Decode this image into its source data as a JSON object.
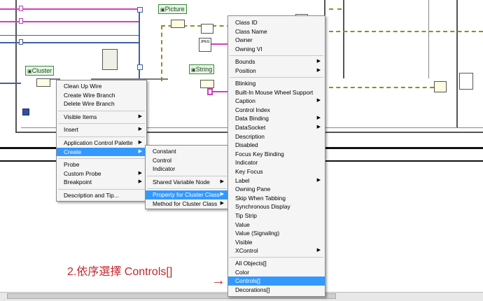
{
  "diagram": {
    "labels": {
      "cluster": "Cluster",
      "picture": "Picture",
      "string": "String",
      "jpeg": "JPEG"
    }
  },
  "context_menu": {
    "items": [
      {
        "label": "Clean Up Wire",
        "submenu": false
      },
      {
        "label": "Create Wire Branch",
        "submenu": false
      },
      {
        "label": "Delete Wire Branch",
        "submenu": false
      },
      {
        "label": "Visible Items",
        "submenu": true
      },
      {
        "label": "Insert",
        "submenu": true
      },
      {
        "label": "Application Control Palette",
        "submenu": true
      },
      {
        "label": "Create",
        "submenu": true,
        "selected": true
      },
      {
        "label": "Probe",
        "submenu": false
      },
      {
        "label": "Custom Probe",
        "submenu": true
      },
      {
        "label": "Breakpoint",
        "submenu": true
      },
      {
        "label": "Description and Tip...",
        "submenu": false
      }
    ]
  },
  "create_menu": {
    "items": [
      {
        "label": "Constant",
        "submenu": false
      },
      {
        "label": "Control",
        "submenu": false
      },
      {
        "label": "Indicator",
        "submenu": false
      },
      {
        "label": "Shared Variable Node",
        "submenu": true
      },
      {
        "label": "Property for Cluster Class",
        "submenu": true,
        "selected": true
      },
      {
        "label": "Method for Cluster Class",
        "submenu": true
      }
    ]
  },
  "property_menu": {
    "items": [
      {
        "label": "Class ID",
        "submenu": false
      },
      {
        "label": "Class Name",
        "submenu": false
      },
      {
        "label": "Owner",
        "submenu": false
      },
      {
        "label": "Owning VI",
        "submenu": false
      },
      {
        "label": "Bounds",
        "submenu": true
      },
      {
        "label": "Position",
        "submenu": true
      },
      {
        "label": "Blinking",
        "submenu": false
      },
      {
        "label": "Built-In Mouse Wheel Support",
        "submenu": false
      },
      {
        "label": "Caption",
        "submenu": true
      },
      {
        "label": "Control Index",
        "submenu": false
      },
      {
        "label": "Data Binding",
        "submenu": true
      },
      {
        "label": "DataSocket",
        "submenu": true
      },
      {
        "label": "Description",
        "submenu": false
      },
      {
        "label": "Disabled",
        "submenu": false
      },
      {
        "label": "Focus Key Binding",
        "submenu": false
      },
      {
        "label": "Indicator",
        "submenu": false
      },
      {
        "label": "Key Focus",
        "submenu": false
      },
      {
        "label": "Label",
        "submenu": true
      },
      {
        "label": "Owning Pane",
        "submenu": false
      },
      {
        "label": "Skip When Tabbing",
        "submenu": false
      },
      {
        "label": "Synchronous Display",
        "submenu": false
      },
      {
        "label": "Tip Strip",
        "submenu": false
      },
      {
        "label": "Value",
        "submenu": false
      },
      {
        "label": "Value (Signaling)",
        "submenu": false
      },
      {
        "label": "Visible",
        "submenu": false
      },
      {
        "label": "XControl",
        "submenu": true
      },
      {
        "label": "All Objects[]",
        "submenu": false
      },
      {
        "label": "Color",
        "submenu": false
      },
      {
        "label": "Controls[]",
        "submenu": false,
        "selected": true
      },
      {
        "label": "Decorations[]",
        "submenu": false
      }
    ]
  },
  "annotation": {
    "text": "2.依序選擇 Controls[]",
    "color": "#c0282d"
  },
  "icons": {
    "submenu_arrow": "▶",
    "annotation_arrow": "→"
  },
  "colors": {
    "menu_highlight": "#3399ff",
    "pink_wire": "#d040c0",
    "blue_wire": "#4060a8",
    "cluster_wire": "#9a8a20"
  }
}
